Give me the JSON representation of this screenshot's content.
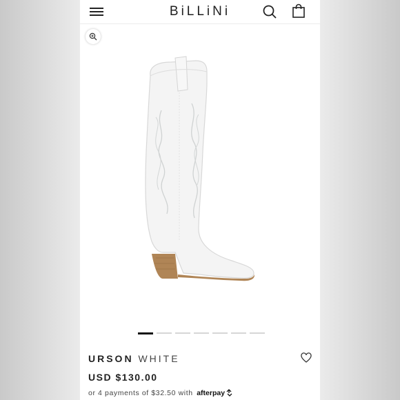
{
  "header": {
    "brand": "BiLLiNi",
    "icons": [
      "menu-icon",
      "search-icon",
      "shopping-bag-icon"
    ]
  },
  "gallery": {
    "zoom_icon": "zoom-in-icon",
    "image_count": 7,
    "active_index": 0
  },
  "product": {
    "name": "URSON",
    "color": "WHITE",
    "price": "USD $130.00",
    "installments": {
      "prefix": "or 4 payments of",
      "amount": "$32.50",
      "with": "with",
      "provider": "afterpay"
    },
    "wishlist_icon": "heart-icon"
  },
  "colors": {
    "background": "#ffffff",
    "text": "#222222",
    "boot": "#f2f2f2",
    "heel": "#b08556"
  }
}
